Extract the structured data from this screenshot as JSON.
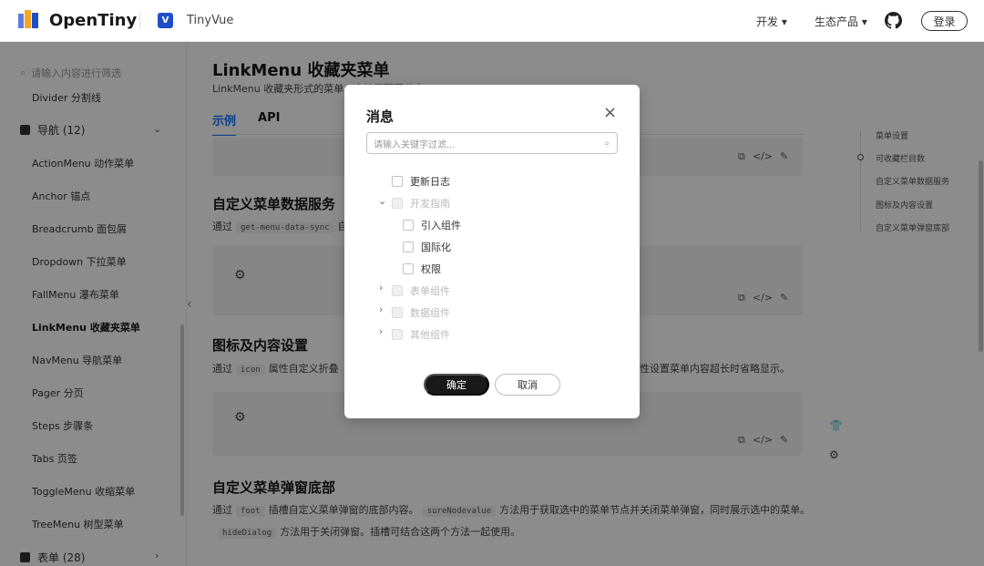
{
  "header": {
    "brand": "OpenTiny",
    "sub_brand": "TinyVue",
    "vue_logo_text": "V",
    "nav": [
      "开发",
      "生态产品"
    ],
    "login": "登录"
  },
  "sidebar": {
    "search_placeholder": "请输入内容进行筛选",
    "top_item": "Divider 分割线",
    "group_nav": "导航 (12)",
    "items": [
      "ActionMenu 动作菜单",
      "Anchor 锚点",
      "Breadcrumb 面包屑",
      "Dropdown 下拉菜单",
      "FallMenu 瀑布菜单",
      "LinkMenu 收藏夹菜单",
      "NavMenu 导航菜单",
      "Pager 分页",
      "Steps 步骤条",
      "Tabs 页签",
      "ToggleMenu 收缩菜单",
      "TreeMenu 树型菜单"
    ],
    "active_index": 5,
    "group_form": "表单 (28)"
  },
  "main": {
    "title": "LinkMenu 收藏夹菜单",
    "desc": "LinkMenu 收藏夹形式的菜单，支持可配置节点。",
    "tabs": [
      "示例",
      "API"
    ],
    "sections": [
      {
        "title": "自定义菜单数据服务",
        "p_prefix": "通过",
        "code": "get-menu-data-sync",
        "p_suffix": "自"
      },
      {
        "title": "图标及内容设置",
        "p_prefix": "通过",
        "code": "icon",
        "p_mid": "属性自定义折叠",
        "p_suffix": "性设置菜单内容超长时省略显示。"
      },
      {
        "title": "自定义菜单弹窗底部",
        "p_prefix": "通过",
        "code": "foot",
        "p_mid": "插槽自定义菜单弹窗的底部内容。",
        "code2": "sureNodevalue",
        "p_suffix": "方法用于获取选中的菜单节点并关闭菜单弹窗，同时展示选中的菜单。",
        "code3": "hideDialog",
        "p_line2": "方法用于关闭弹窗。插槽可结合这两个方法一起使用。"
      }
    ]
  },
  "anchor": {
    "items": [
      "菜单设置",
      "可收藏栏目数",
      "自定义菜单数据服务",
      "图标及内容设置",
      "自定义菜单弹窗底部"
    ]
  },
  "dialog": {
    "title": "消息",
    "search_placeholder": "请输入关键字过滤...",
    "tree": [
      {
        "label": "更新日志",
        "disabled": false
      },
      {
        "label": "开发指南",
        "disabled": true,
        "expanded": true
      },
      {
        "label": "引入组件",
        "disabled": false
      },
      {
        "label": "国际化",
        "disabled": false
      },
      {
        "label": "权限",
        "disabled": false
      },
      {
        "label": "表单组件",
        "disabled": true
      },
      {
        "label": "数据组件",
        "disabled": true
      },
      {
        "label": "其他组件",
        "disabled": true
      }
    ],
    "ok": "确定",
    "cancel": "取消"
  }
}
